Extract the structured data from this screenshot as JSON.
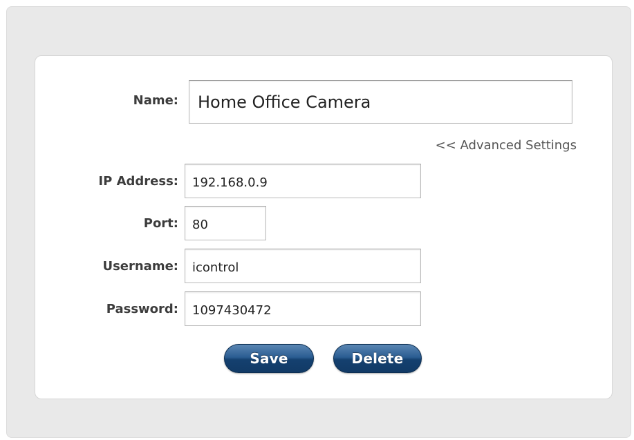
{
  "form": {
    "name_label": "Name:",
    "name_value": "Home Office Camera",
    "advanced_link": "<< Advanced Settings",
    "ip_label": "IP Address:",
    "ip_value": "192.168.0.9",
    "port_label": "Port:",
    "port_value": "80",
    "username_label": "Username:",
    "username_value": "icontrol",
    "password_label": "Password:",
    "password_value": "1097430472",
    "save_label": "Save",
    "delete_label": "Delete"
  },
  "colors": {
    "button_blue": "#1d4a7a",
    "panel_gray": "#e9e9e9",
    "label_text": "#3c3c3c"
  }
}
